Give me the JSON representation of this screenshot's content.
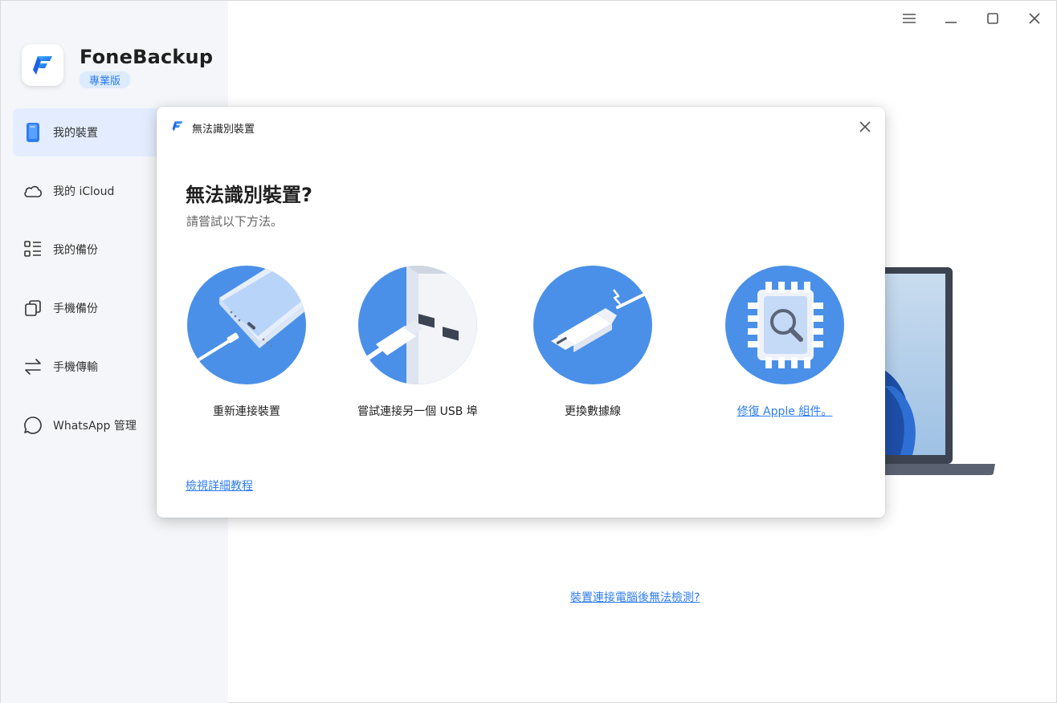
{
  "app": {
    "brand_name": "FoneBackup",
    "edition_badge": "專業版"
  },
  "sidebar": {
    "items": [
      {
        "label": "我的裝置",
        "icon": "phone-icon",
        "active": true
      },
      {
        "label": "我的 iCloud",
        "icon": "cloud-icon",
        "active": false
      },
      {
        "label": "我的備份",
        "icon": "list-icon",
        "active": false
      },
      {
        "label": "手機備份",
        "icon": "copy-icon",
        "active": false
      },
      {
        "label": "手機傳輸",
        "icon": "transfer-icon",
        "active": false
      },
      {
        "label": "WhatsApp 管理",
        "icon": "chat-bubble-icon",
        "active": false
      }
    ]
  },
  "window_controls": [
    "menu-icon",
    "minimize-icon",
    "maximize-icon",
    "close-icon"
  ],
  "main": {
    "bottom_link": "裝置連接電腦後無法檢測?"
  },
  "modal": {
    "window_title": "無法識別裝置",
    "heading": "無法識別裝置?",
    "subheading": "請嘗試以下方法。",
    "options": [
      {
        "label": "重新連接裝置",
        "icon": "reconnect-device-icon",
        "is_link": false
      },
      {
        "label": "嘗試連接另一個 USB 埠",
        "icon": "usb-port-icon",
        "is_link": false
      },
      {
        "label": "更換數據線",
        "icon": "usb-cable-icon",
        "is_link": false
      },
      {
        "label": "修復 Apple 組件。",
        "icon": "repair-chip-icon",
        "is_link": true
      }
    ],
    "footer_link": "檢視詳細教程"
  },
  "colors": {
    "accent": "#2f7df2",
    "circle_blue": "#4a90e8",
    "sidebar_bg": "#f4f6f9",
    "active_item_bg": "#e3edff"
  }
}
